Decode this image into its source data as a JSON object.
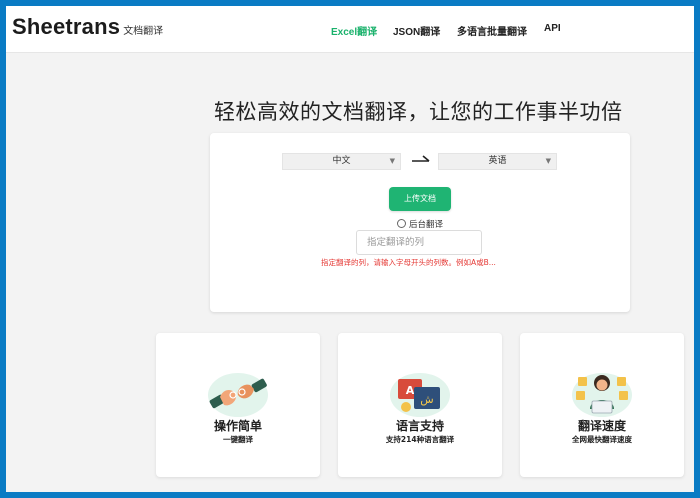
{
  "header": {
    "logo": "Sheetrans",
    "logo_sub": "文档翻译",
    "nav": [
      "Excel翻译",
      "JSON翻译",
      "多语言批量翻译",
      "API"
    ]
  },
  "main": {
    "headline": "轻松高效的文档翻译，让您的工作事半功倍",
    "source_lang": "中文",
    "target_lang": "英语",
    "upload_label": "上传文档",
    "background_label": "后台翻译",
    "column_placeholder": "指定翻译的列",
    "hint": "指定翻译的列，请输入字母开头的列数。例如A或B..."
  },
  "features": [
    {
      "title": "操作简单",
      "subtitle": "一键翻译",
      "icon": "hands-icon"
    },
    {
      "title": "语言支持",
      "subtitle": "支持214种语言翻译",
      "icon": "language-icon"
    },
    {
      "title": "翻译速度",
      "subtitle": "全网最快翻译速度",
      "icon": "translator-person-icon"
    }
  ],
  "colors": {
    "accent": "#1fb473",
    "nav_active": "#19b16b",
    "hint": "#e53935",
    "frame": "#0a7bc4"
  }
}
